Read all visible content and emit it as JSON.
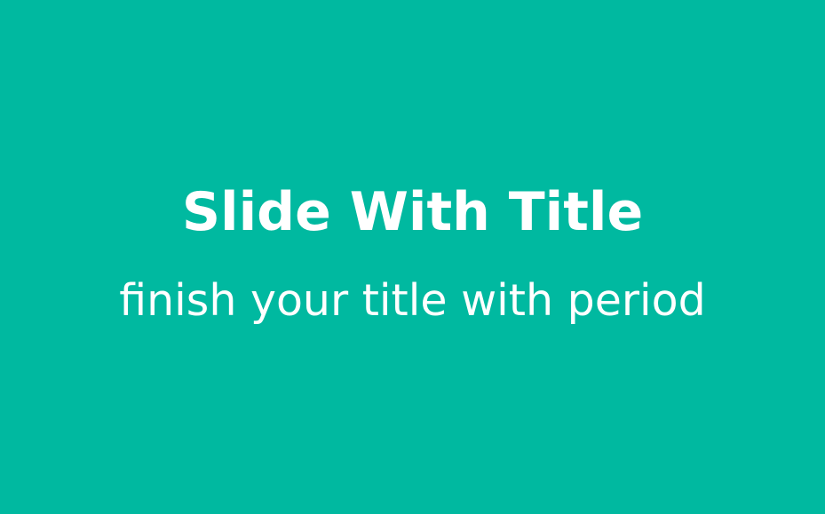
{
  "slide": {
    "title": "Slide With Title",
    "subtitle": "finish your title with period",
    "colors": {
      "background": "#00b9a0",
      "text": "#ffffff"
    }
  }
}
